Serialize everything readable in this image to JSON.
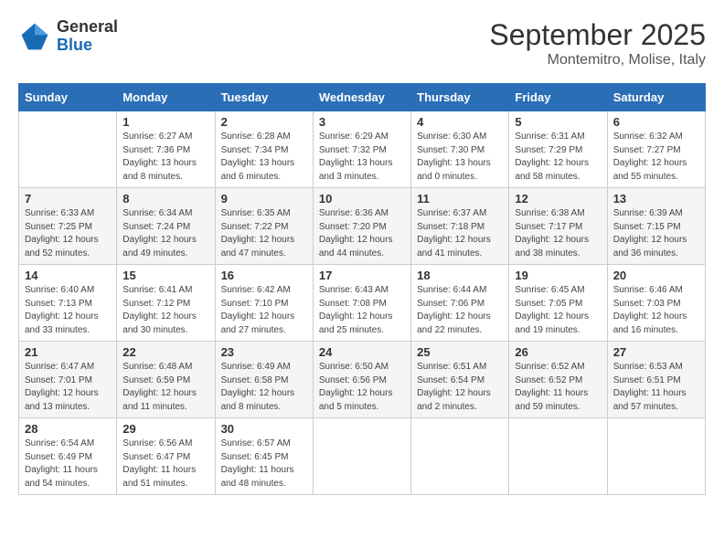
{
  "header": {
    "logo_general": "General",
    "logo_blue": "Blue",
    "month_title": "September 2025",
    "location": "Montemitro, Molise, Italy"
  },
  "days_of_week": [
    "Sunday",
    "Monday",
    "Tuesday",
    "Wednesday",
    "Thursday",
    "Friday",
    "Saturday"
  ],
  "weeks": [
    [
      {
        "day": "",
        "sunrise": "",
        "sunset": "",
        "daylight": ""
      },
      {
        "day": "1",
        "sunrise": "Sunrise: 6:27 AM",
        "sunset": "Sunset: 7:36 PM",
        "daylight": "Daylight: 13 hours and 8 minutes."
      },
      {
        "day": "2",
        "sunrise": "Sunrise: 6:28 AM",
        "sunset": "Sunset: 7:34 PM",
        "daylight": "Daylight: 13 hours and 6 minutes."
      },
      {
        "day": "3",
        "sunrise": "Sunrise: 6:29 AM",
        "sunset": "Sunset: 7:32 PM",
        "daylight": "Daylight: 13 hours and 3 minutes."
      },
      {
        "day": "4",
        "sunrise": "Sunrise: 6:30 AM",
        "sunset": "Sunset: 7:30 PM",
        "daylight": "Daylight: 13 hours and 0 minutes."
      },
      {
        "day": "5",
        "sunrise": "Sunrise: 6:31 AM",
        "sunset": "Sunset: 7:29 PM",
        "daylight": "Daylight: 12 hours and 58 minutes."
      },
      {
        "day": "6",
        "sunrise": "Sunrise: 6:32 AM",
        "sunset": "Sunset: 7:27 PM",
        "daylight": "Daylight: 12 hours and 55 minutes."
      }
    ],
    [
      {
        "day": "7",
        "sunrise": "Sunrise: 6:33 AM",
        "sunset": "Sunset: 7:25 PM",
        "daylight": "Daylight: 12 hours and 52 minutes."
      },
      {
        "day": "8",
        "sunrise": "Sunrise: 6:34 AM",
        "sunset": "Sunset: 7:24 PM",
        "daylight": "Daylight: 12 hours and 49 minutes."
      },
      {
        "day": "9",
        "sunrise": "Sunrise: 6:35 AM",
        "sunset": "Sunset: 7:22 PM",
        "daylight": "Daylight: 12 hours and 47 minutes."
      },
      {
        "day": "10",
        "sunrise": "Sunrise: 6:36 AM",
        "sunset": "Sunset: 7:20 PM",
        "daylight": "Daylight: 12 hours and 44 minutes."
      },
      {
        "day": "11",
        "sunrise": "Sunrise: 6:37 AM",
        "sunset": "Sunset: 7:18 PM",
        "daylight": "Daylight: 12 hours and 41 minutes."
      },
      {
        "day": "12",
        "sunrise": "Sunrise: 6:38 AM",
        "sunset": "Sunset: 7:17 PM",
        "daylight": "Daylight: 12 hours and 38 minutes."
      },
      {
        "day": "13",
        "sunrise": "Sunrise: 6:39 AM",
        "sunset": "Sunset: 7:15 PM",
        "daylight": "Daylight: 12 hours and 36 minutes."
      }
    ],
    [
      {
        "day": "14",
        "sunrise": "Sunrise: 6:40 AM",
        "sunset": "Sunset: 7:13 PM",
        "daylight": "Daylight: 12 hours and 33 minutes."
      },
      {
        "day": "15",
        "sunrise": "Sunrise: 6:41 AM",
        "sunset": "Sunset: 7:12 PM",
        "daylight": "Daylight: 12 hours and 30 minutes."
      },
      {
        "day": "16",
        "sunrise": "Sunrise: 6:42 AM",
        "sunset": "Sunset: 7:10 PM",
        "daylight": "Daylight: 12 hours and 27 minutes."
      },
      {
        "day": "17",
        "sunrise": "Sunrise: 6:43 AM",
        "sunset": "Sunset: 7:08 PM",
        "daylight": "Daylight: 12 hours and 25 minutes."
      },
      {
        "day": "18",
        "sunrise": "Sunrise: 6:44 AM",
        "sunset": "Sunset: 7:06 PM",
        "daylight": "Daylight: 12 hours and 22 minutes."
      },
      {
        "day": "19",
        "sunrise": "Sunrise: 6:45 AM",
        "sunset": "Sunset: 7:05 PM",
        "daylight": "Daylight: 12 hours and 19 minutes."
      },
      {
        "day": "20",
        "sunrise": "Sunrise: 6:46 AM",
        "sunset": "Sunset: 7:03 PM",
        "daylight": "Daylight: 12 hours and 16 minutes."
      }
    ],
    [
      {
        "day": "21",
        "sunrise": "Sunrise: 6:47 AM",
        "sunset": "Sunset: 7:01 PM",
        "daylight": "Daylight: 12 hours and 13 minutes."
      },
      {
        "day": "22",
        "sunrise": "Sunrise: 6:48 AM",
        "sunset": "Sunset: 6:59 PM",
        "daylight": "Daylight: 12 hours and 11 minutes."
      },
      {
        "day": "23",
        "sunrise": "Sunrise: 6:49 AM",
        "sunset": "Sunset: 6:58 PM",
        "daylight": "Daylight: 12 hours and 8 minutes."
      },
      {
        "day": "24",
        "sunrise": "Sunrise: 6:50 AM",
        "sunset": "Sunset: 6:56 PM",
        "daylight": "Daylight: 12 hours and 5 minutes."
      },
      {
        "day": "25",
        "sunrise": "Sunrise: 6:51 AM",
        "sunset": "Sunset: 6:54 PM",
        "daylight": "Daylight: 12 hours and 2 minutes."
      },
      {
        "day": "26",
        "sunrise": "Sunrise: 6:52 AM",
        "sunset": "Sunset: 6:52 PM",
        "daylight": "Daylight: 11 hours and 59 minutes."
      },
      {
        "day": "27",
        "sunrise": "Sunrise: 6:53 AM",
        "sunset": "Sunset: 6:51 PM",
        "daylight": "Daylight: 11 hours and 57 minutes."
      }
    ],
    [
      {
        "day": "28",
        "sunrise": "Sunrise: 6:54 AM",
        "sunset": "Sunset: 6:49 PM",
        "daylight": "Daylight: 11 hours and 54 minutes."
      },
      {
        "day": "29",
        "sunrise": "Sunrise: 6:56 AM",
        "sunset": "Sunset: 6:47 PM",
        "daylight": "Daylight: 11 hours and 51 minutes."
      },
      {
        "day": "30",
        "sunrise": "Sunrise: 6:57 AM",
        "sunset": "Sunset: 6:45 PM",
        "daylight": "Daylight: 11 hours and 48 minutes."
      },
      {
        "day": "",
        "sunrise": "",
        "sunset": "",
        "daylight": ""
      },
      {
        "day": "",
        "sunrise": "",
        "sunset": "",
        "daylight": ""
      },
      {
        "day": "",
        "sunrise": "",
        "sunset": "",
        "daylight": ""
      },
      {
        "day": "",
        "sunrise": "",
        "sunset": "",
        "daylight": ""
      }
    ]
  ]
}
